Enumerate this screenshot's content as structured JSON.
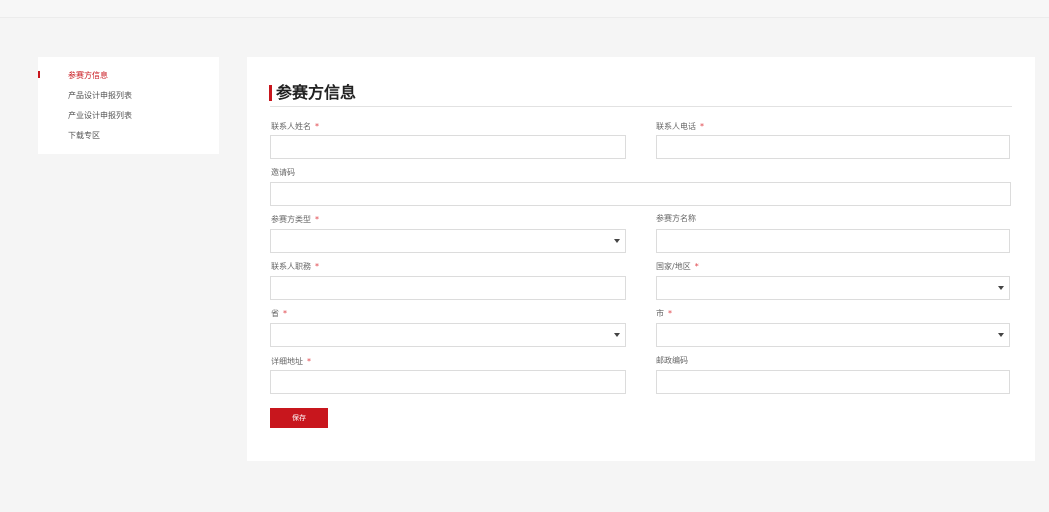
{
  "sidebar": {
    "items": [
      {
        "label": "参赛方信息",
        "active": true
      },
      {
        "label": "产品设计申报列表",
        "active": false
      },
      {
        "label": "产业设计申报列表",
        "active": false
      },
      {
        "label": "下载专区",
        "active": false
      }
    ]
  },
  "form": {
    "title": "参赛方信息",
    "required_mark": "*",
    "fields": {
      "contact_name": {
        "label": "联系人姓名",
        "required": true,
        "value": ""
      },
      "contact_phone": {
        "label": "联系人电话",
        "required": true,
        "value": ""
      },
      "invite_code": {
        "label": "邀请码",
        "required": false,
        "value": ""
      },
      "participant_type": {
        "label": "参赛方类型",
        "required": true,
        "value": ""
      },
      "participant_name": {
        "label": "参赛方名称",
        "required": false,
        "value": ""
      },
      "contact_position": {
        "label": "联系人职務",
        "required": true,
        "value": ""
      },
      "country_region": {
        "label": "国家/地区",
        "required": true,
        "value": ""
      },
      "province": {
        "label": "省",
        "required": true,
        "value": ""
      },
      "city": {
        "label": "市",
        "required": true,
        "value": ""
      },
      "address": {
        "label": "详细地址",
        "required": true,
        "value": ""
      },
      "postcode": {
        "label": "邮政编码",
        "required": false,
        "value": ""
      }
    },
    "save_label": "保存"
  },
  "colors": {
    "accent": "#c8161d",
    "required_star": "#e0454b",
    "page_bg": "#f5f5f5",
    "panel_bg": "#ffffff",
    "field_border": "#dcdcdc"
  },
  "icons": {
    "select_arrow": "chevron-down-icon",
    "active_marker": "red-bar-marker"
  }
}
